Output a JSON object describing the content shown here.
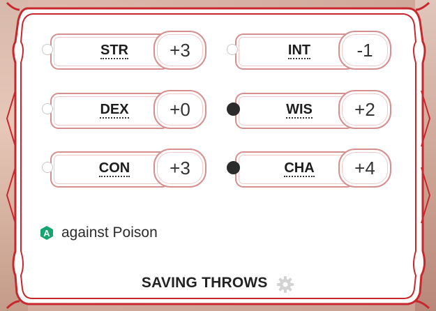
{
  "abilities": [
    {
      "label": "STR",
      "modifier": "+3",
      "proficient": false
    },
    {
      "label": "INT",
      "modifier": "-1",
      "proficient": false
    },
    {
      "label": "DEX",
      "modifier": "+0",
      "proficient": false
    },
    {
      "label": "WIS",
      "modifier": "+2",
      "proficient": true
    },
    {
      "label": "CON",
      "modifier": "+3",
      "proficient": false
    },
    {
      "label": "CHA",
      "modifier": "+4",
      "proficient": true
    }
  ],
  "advantage": {
    "icon": "advantage-icon",
    "badge_letter": "A",
    "text": "against Poison",
    "color": "#16a46f"
  },
  "footer": {
    "title": "SAVING THROWS",
    "icon": "gear-icon"
  },
  "colors": {
    "frame": "#c8282d",
    "pill_border": "#d68f8f",
    "text": "#1d1d1d"
  }
}
